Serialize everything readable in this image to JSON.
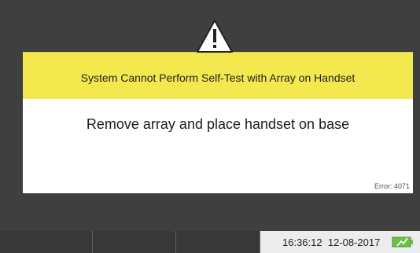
{
  "dialog": {
    "icon": "warning-triangle-icon",
    "title": "System Cannot Perform Self-Test with Array on Handset",
    "message": "Remove array and place handset on base",
    "error_code": "Error: 4071",
    "banner_color": "#f3e84e"
  },
  "status_bar": {
    "time": "16:36:12",
    "date": "12-08-2017",
    "battery_icon": "battery-charging-icon",
    "battery_color": "#6cc04a"
  },
  "softkeys": [
    {
      "label": ""
    },
    {
      "label": ""
    },
    {
      "label": ""
    }
  ]
}
